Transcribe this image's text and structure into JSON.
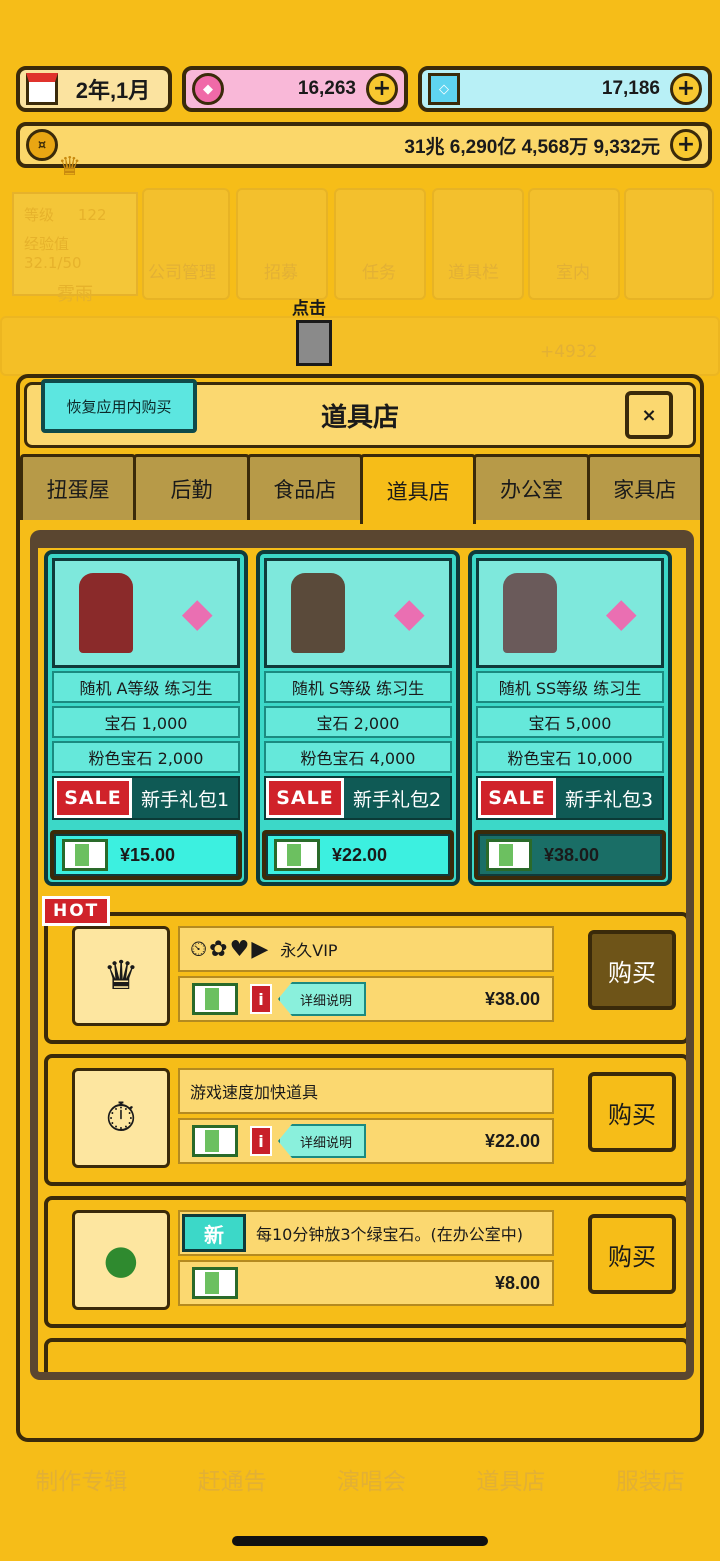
{
  "resources": {
    "date": "2年,1月",
    "pink_gems": "16,263",
    "cyan_gems": "17,186",
    "money": "31兆 6,290亿 4,568万 9,332元",
    "plus": "+"
  },
  "background": {
    "level_label": "等级",
    "level_value": "122",
    "exp_label": "经验值",
    "exp_value": "32.1/50",
    "weather": "雾雨",
    "menu": [
      "公司管理",
      "招募",
      "任务",
      "道具栏",
      "室内"
    ],
    "banner_value": "+4932"
  },
  "tap_hint": "点击",
  "shop": {
    "restore_label": "恢复应用内购买",
    "title": "道具店",
    "close_icon": "×",
    "tabs": [
      "扭蛋屋",
      "后勤",
      "食品店",
      "道具店",
      "办公室",
      "家具店"
    ],
    "active_tab": 3,
    "packs": [
      {
        "trainee": "随机 A等级 练习生",
        "gems": "宝石 1,000",
        "pink": "粉色宝石 2,000",
        "sale": "SALE",
        "name": "新手礼包1",
        "price": "¥15.00"
      },
      {
        "trainee": "随机 S等级 练习生",
        "gems": "宝石 2,000",
        "pink": "粉色宝石 4,000",
        "sale": "SALE",
        "name": "新手礼包2",
        "price": "¥22.00"
      },
      {
        "trainee": "随机 SS等级 练习生",
        "gems": "宝石 5,000",
        "pink": "粉色宝石 10,000",
        "sale": "SALE",
        "name": "新手礼包3",
        "price": "¥38.00"
      }
    ],
    "items": [
      {
        "tag": "HOT",
        "title": "永久VIP",
        "info": "i",
        "detail": "详细说明",
        "price": "¥38.00",
        "buy": "购买"
      },
      {
        "title": "游戏速度加快道具",
        "info": "i",
        "detail": "详细说明",
        "price": "¥22.00",
        "buy": "购买"
      },
      {
        "tag": "新",
        "title": "每10分钟放3个绿宝石。(在办公室中)",
        "price": "¥8.00",
        "buy": "购买"
      }
    ]
  },
  "bottom_nav": [
    "制作专辑",
    "赶通告",
    "演唱会",
    "道具店",
    "服装店"
  ],
  "colors": {
    "background": "#f6bd18",
    "outline": "#3a2a0a",
    "teal": "#3cd8c8",
    "sale_red": "#d0222a"
  }
}
